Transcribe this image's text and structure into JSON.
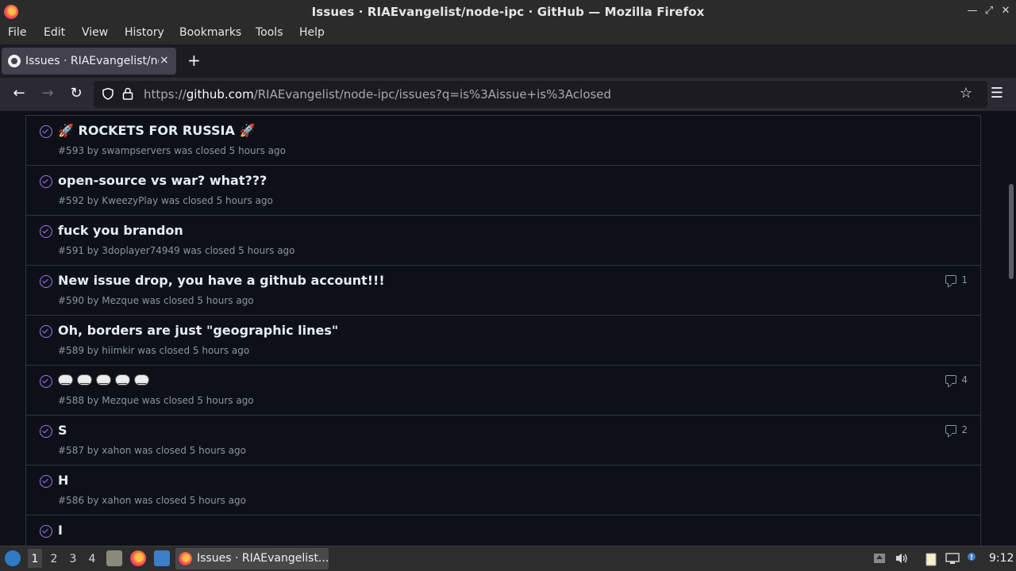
{
  "window": {
    "title": "Issues · RIAEvangelist/node-ipc · GitHub — Mozilla Firefox",
    "minimize": "—",
    "maximize": "⤢",
    "close": "✕"
  },
  "menu": [
    "File",
    "Edit",
    "View",
    "History",
    "Bookmarks",
    "Tools",
    "Help"
  ],
  "tabs": [
    {
      "label": "Issues · RIAEvangelist/node-ipc · GitHub",
      "close": "×"
    }
  ],
  "new_tab": "+",
  "nav": {
    "back": "←",
    "forward": "→",
    "reload": "↻",
    "url_prefix": "https://",
    "url_host": "github.com",
    "url_path": "/RIAEvangelist/node-ipc/issues?q=is%3Aissue+is%3Aclosed",
    "bookmark": "☆",
    "menu": "☰"
  },
  "issues": [
    {
      "title": "🚀 ROCKETS FOR RUSSIA 🚀",
      "meta": "#593 by swampservers was closed 5 hours ago",
      "comments": ""
    },
    {
      "title": "open-source vs war? what???",
      "meta": "#592 by KweezyPlay was closed 5 hours ago",
      "comments": ""
    },
    {
      "title": "fuck you brandon",
      "meta": "#591 by 3doplayer74949 was closed 5 hours ago",
      "comments": ""
    },
    {
      "title": "New issue drop, you have a github account!!!",
      "meta": "#590 by Mezque was closed 5 hours ago",
      "comments": "1"
    },
    {
      "title": "Oh, borders are just \"geographic lines\"",
      "meta": "#589 by hiimkir was closed 5 hours ago",
      "comments": ""
    },
    {
      "title": "",
      "meta": "#588 by Mezque was closed 5 hours ago",
      "comments": "4",
      "emoji_count": 5
    },
    {
      "title": "S",
      "meta": "#587 by xahon was closed 5 hours ago",
      "comments": "2"
    },
    {
      "title": "H",
      "meta": "#586 by xahon was closed 5 hours ago",
      "comments": ""
    },
    {
      "title": "I",
      "meta": "",
      "comments": ""
    }
  ],
  "taskbar": {
    "workspaces": [
      "1",
      "2",
      "3",
      "4"
    ],
    "active_workspace": "1",
    "task_label": "Issues · RIAEvangelist...",
    "clock": "9:12"
  }
}
